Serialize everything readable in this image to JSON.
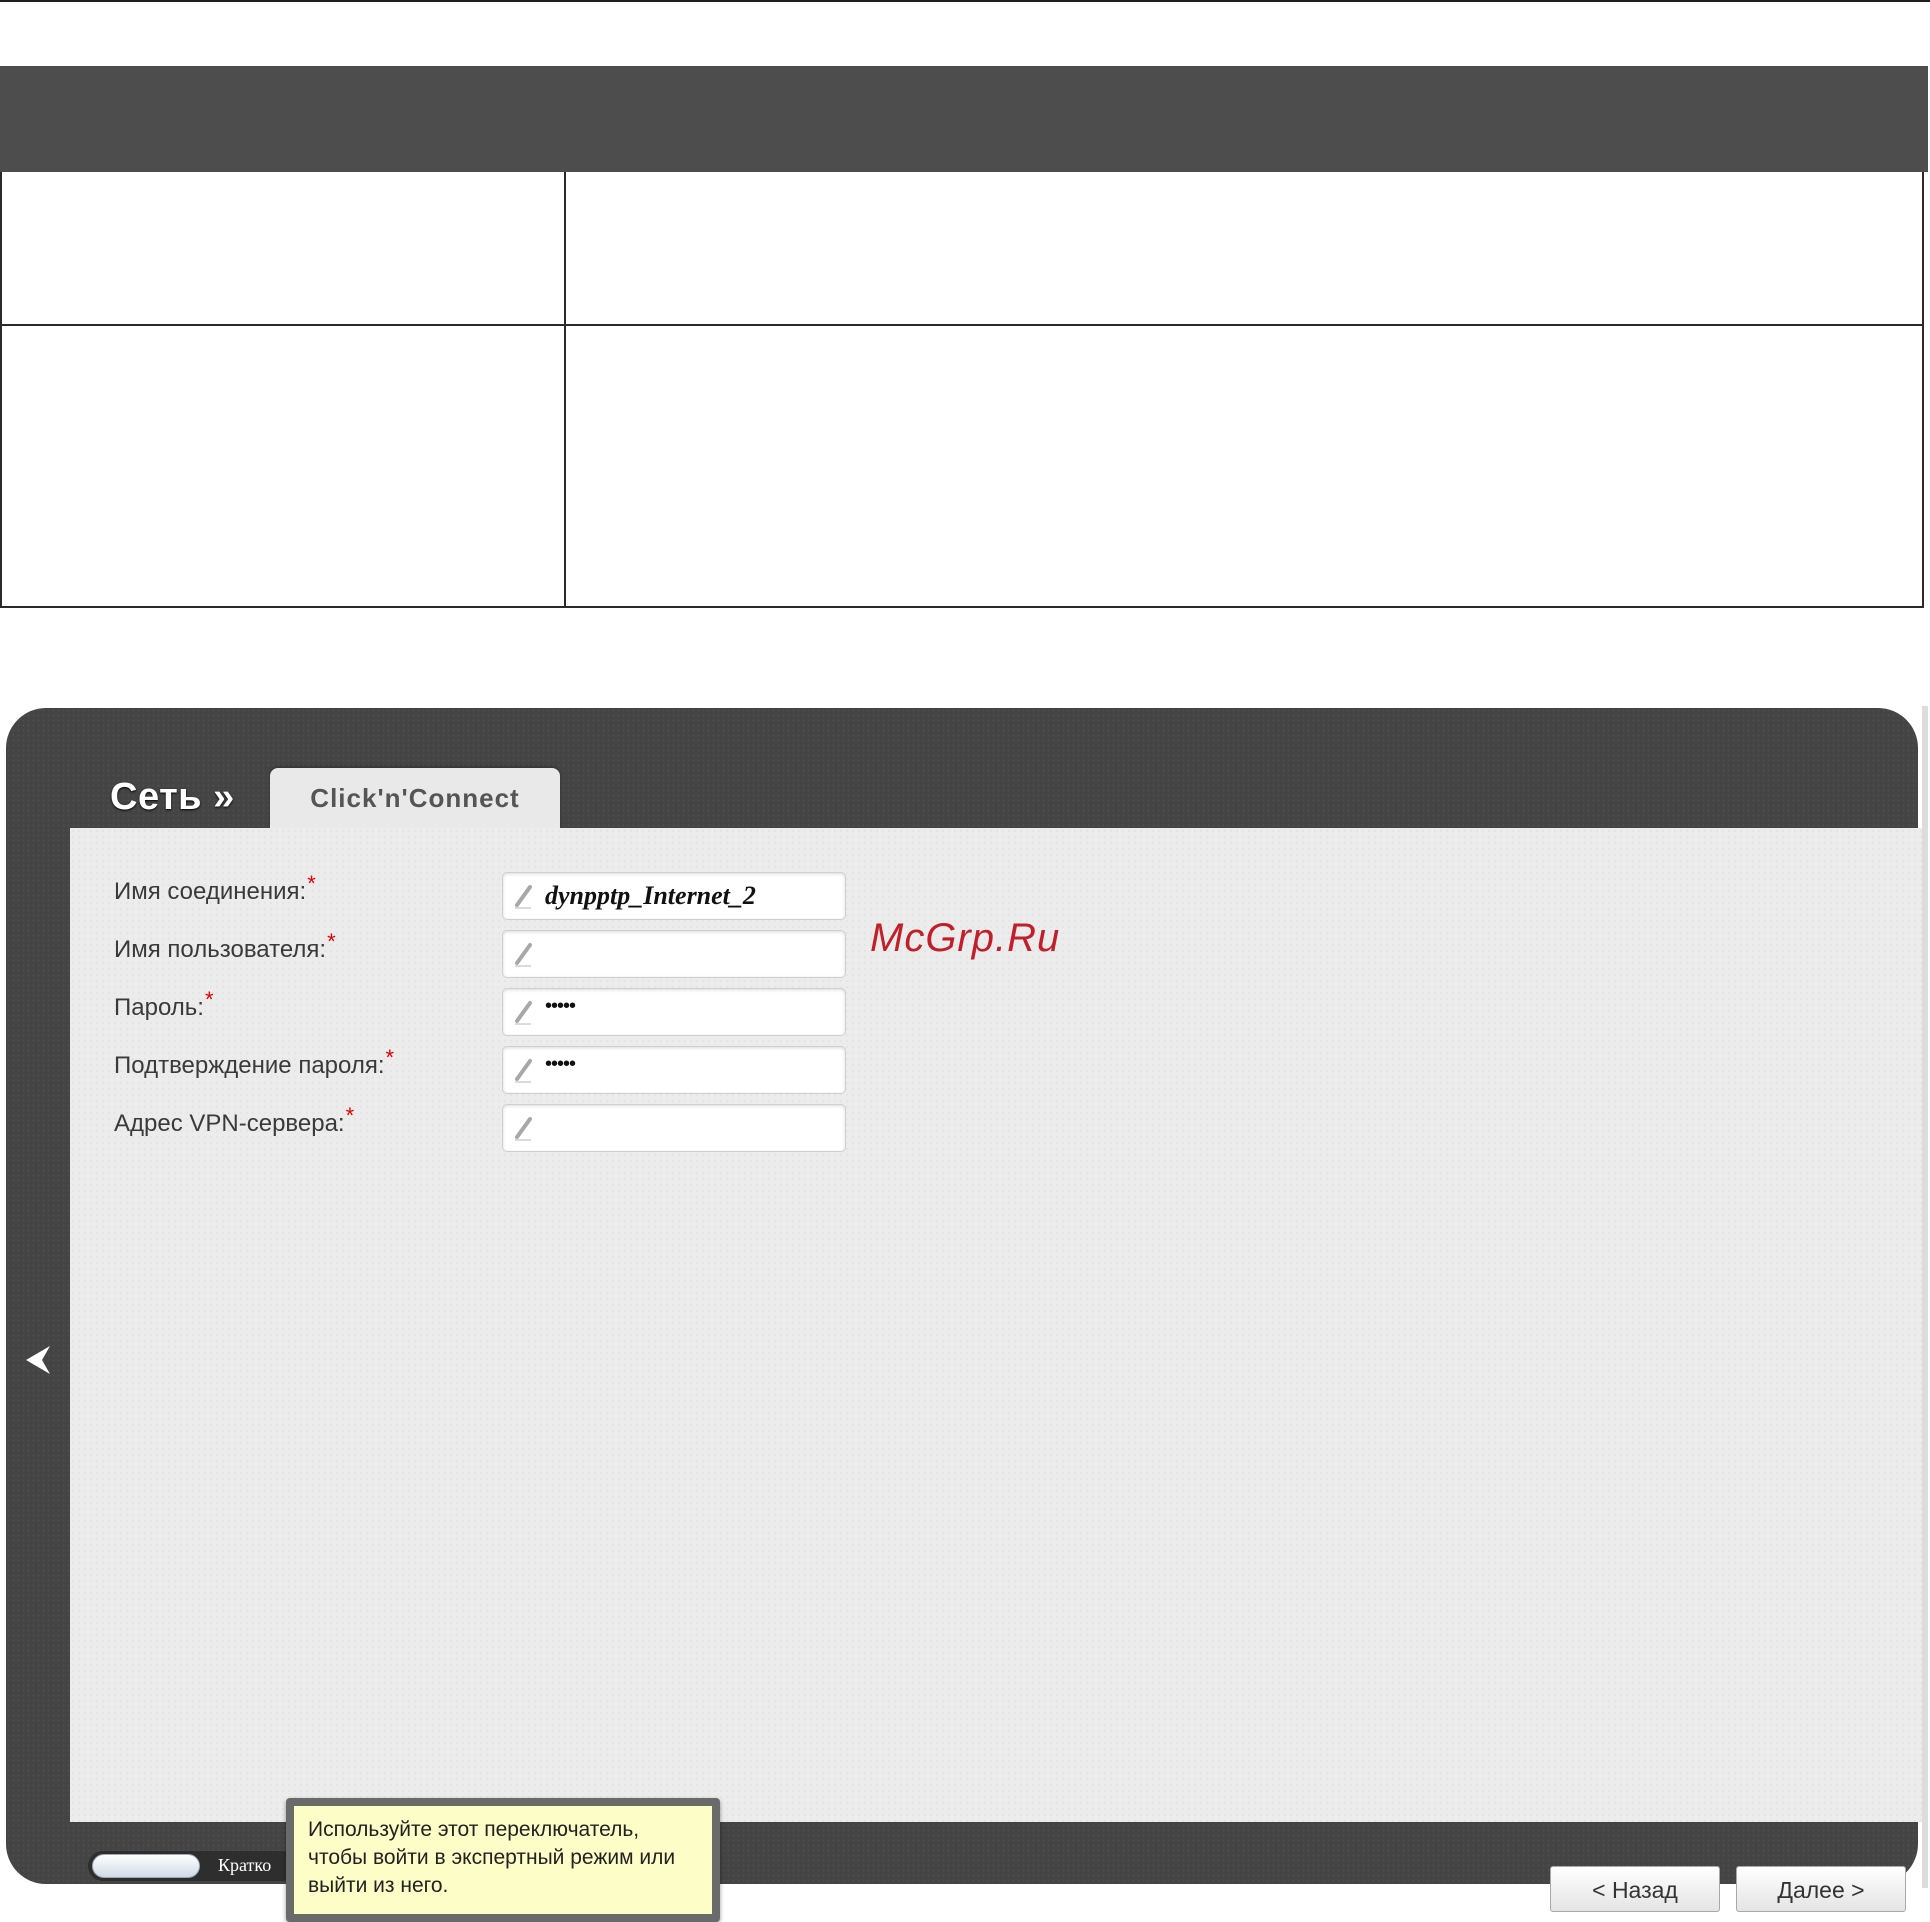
{
  "breadcrumb": "Сеть »",
  "tab_label": "Click'n'Connect",
  "fields": [
    {
      "label": "Имя соединения:",
      "required": "*",
      "value": "dynpptp_Internet_2"
    },
    {
      "label": "Имя пользователя:",
      "required": "*",
      "value": ""
    },
    {
      "label": "Пароль:",
      "required": "*",
      "value": "•••••"
    },
    {
      "label": "Подтверждение пароля:",
      "required": "*",
      "value": "•••••"
    },
    {
      "label": "Адрес VPN-сервера:",
      "required": "*",
      "value": ""
    }
  ],
  "watermark": "McGrp.Ru",
  "mode_toggle": {
    "label": "Кратко"
  },
  "tooltip": {
    "lines": [
      "Используйте этот переключатель,",
      "чтобы войти в экспертный режим или",
      "выйти из него."
    ]
  },
  "buttons": {
    "back": "< Назад",
    "next": "Далее >"
  },
  "colors": {
    "frame": "#444444",
    "content": "#ececec",
    "required": "#e00000",
    "tooltip": "#fdfdc8",
    "watermark": "#c0202a"
  }
}
